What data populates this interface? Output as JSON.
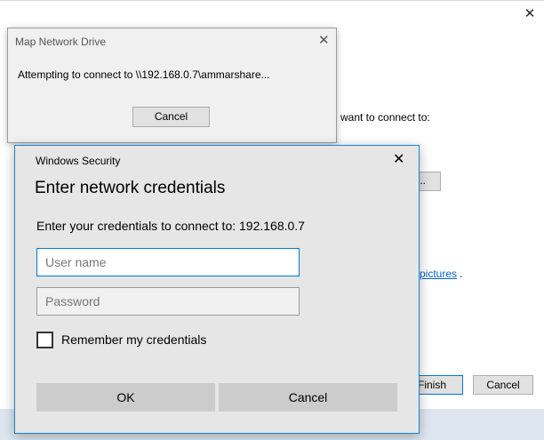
{
  "background_wizard": {
    "close_glyph": "✕",
    "connect_text": "want to connect to:",
    "browse_label": "...",
    "link_text": "pictures",
    "link_suffix": ".",
    "finish_label": "Finish",
    "cancel_label": "Cancel"
  },
  "map_dialog": {
    "title": "Map Network Drive",
    "close_glyph": "✕",
    "message": "Attempting to connect to \\\\192.168.0.7\\ammarshare...",
    "cancel_label": "Cancel"
  },
  "security_dialog": {
    "title": "Windows Security",
    "close_glyph": "✕",
    "heading": "Enter network credentials",
    "subtitle": "Enter your credentials to connect to: 192.168.0.7",
    "username_placeholder": "User name",
    "username_value": "",
    "password_placeholder": "Password",
    "password_value": "",
    "remember_label": "Remember my credentials",
    "remember_checked": false,
    "ok_label": "OK",
    "cancel_label": "Cancel"
  },
  "colors": {
    "accent": "#0078d7",
    "link": "#0066cc",
    "dialog_bg": "#e6e6e6",
    "button_bg": "#cccccc"
  }
}
